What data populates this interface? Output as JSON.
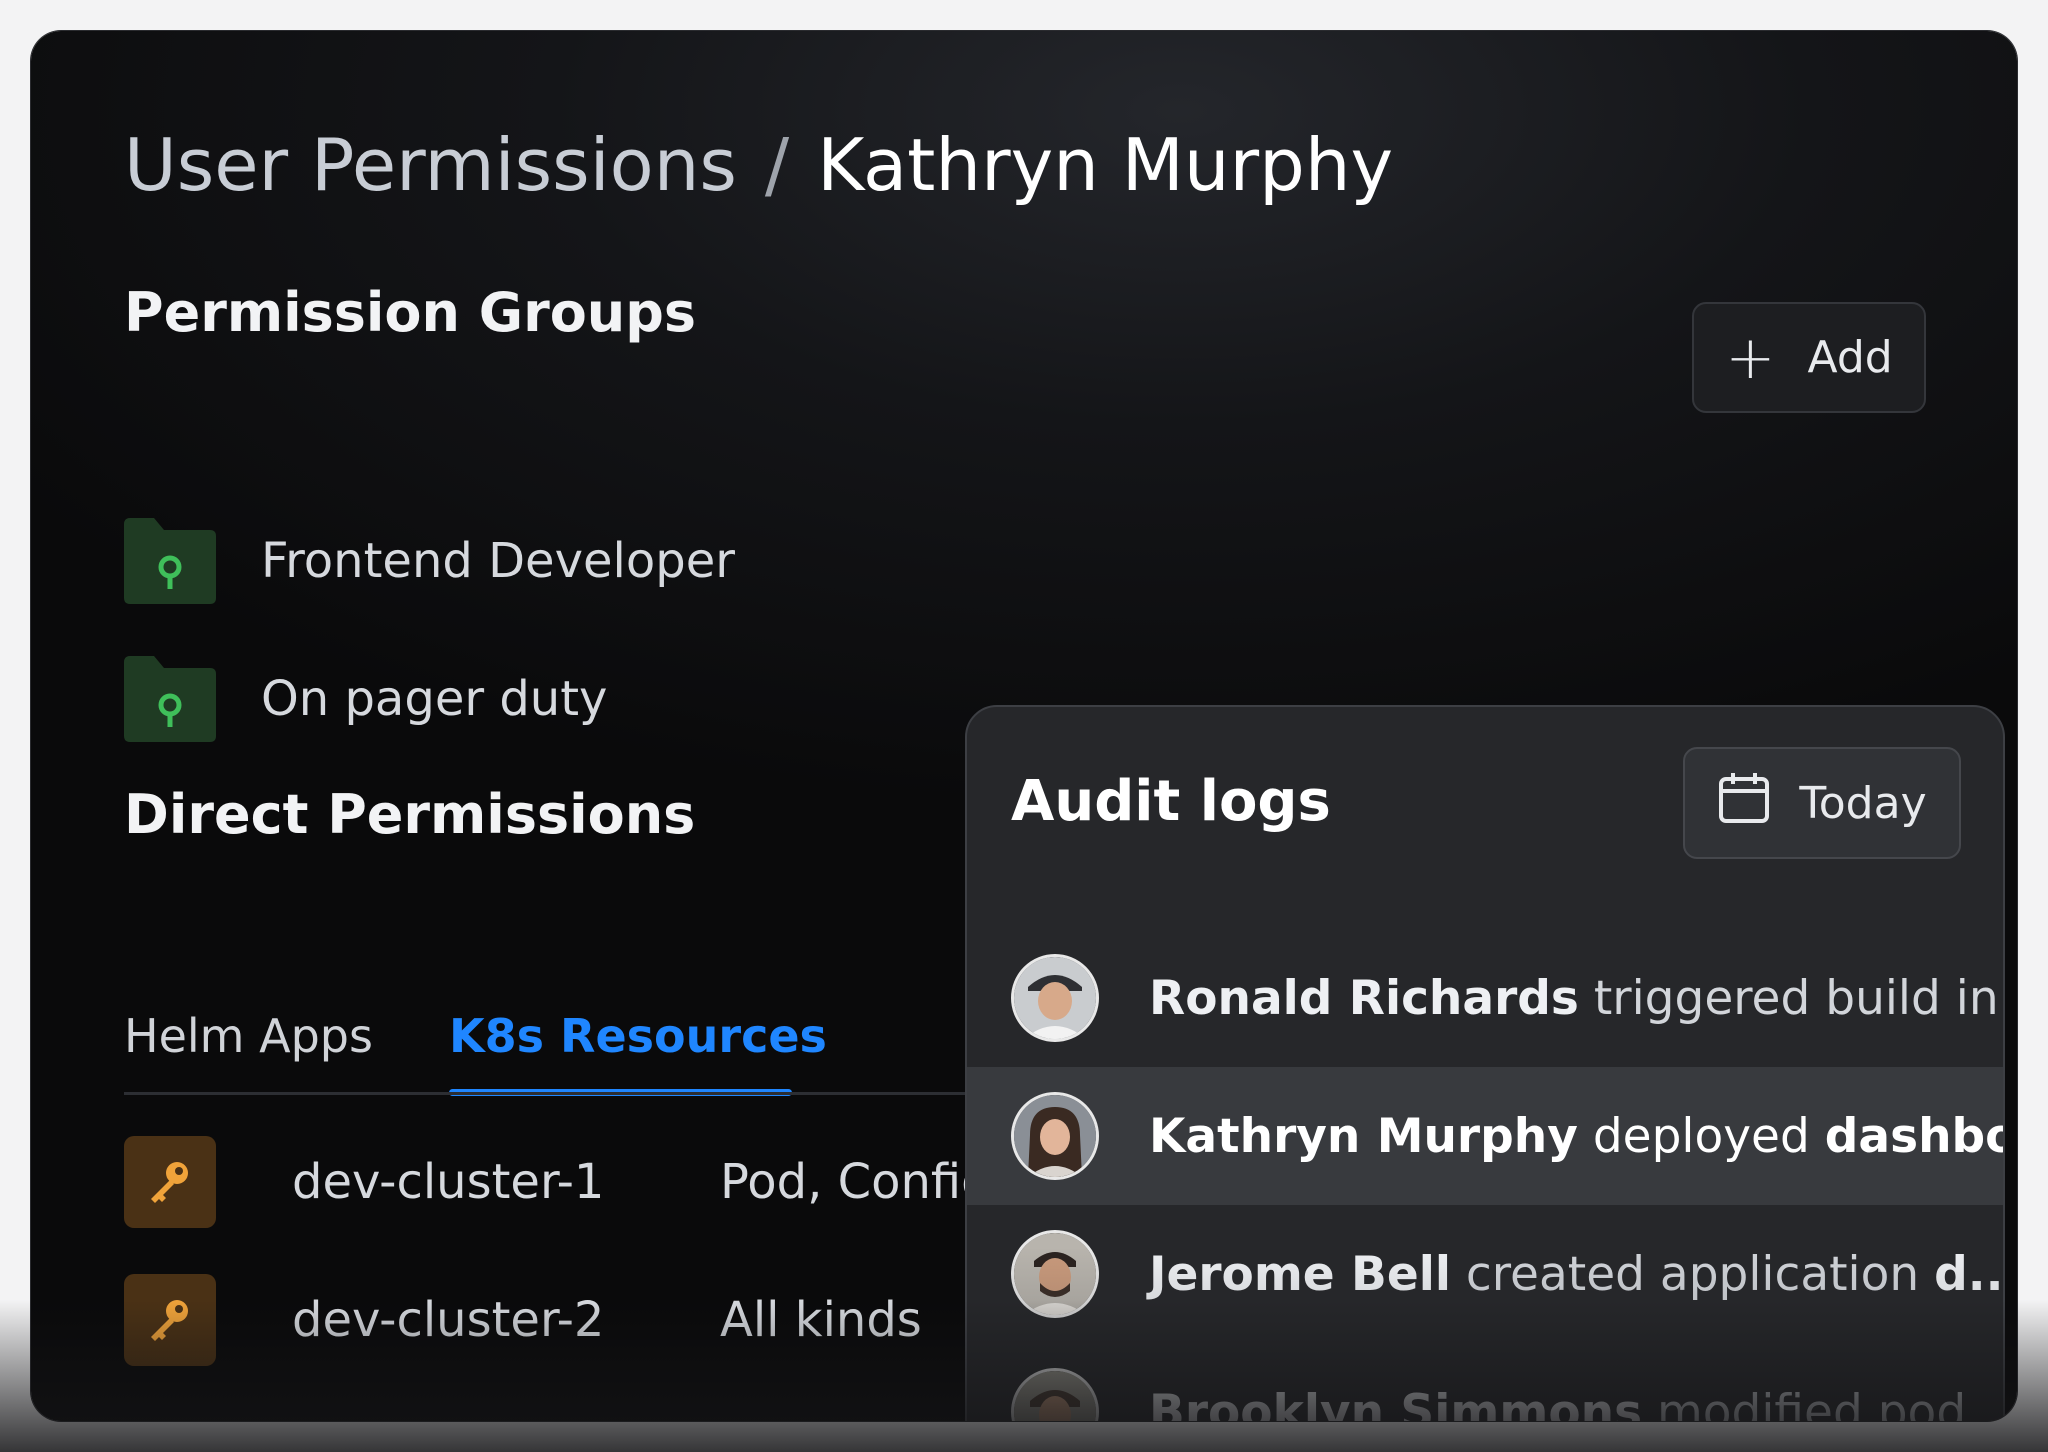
{
  "breadcrumb": {
    "parent": "User Permissions",
    "separator": "/",
    "current": "Kathryn Murphy"
  },
  "permission_groups": {
    "title": "Permission Groups",
    "add_label": "Add",
    "add_icon": "plus-icon",
    "items": [
      {
        "label": "Frontend Developer",
        "icon": "folder-key-icon"
      },
      {
        "label": "On pager duty",
        "icon": "folder-key-icon"
      }
    ]
  },
  "direct_permissions": {
    "title": "Direct Permissions",
    "tabs": [
      {
        "label": "Helm Apps",
        "active": false
      },
      {
        "label": "K8s Resources",
        "active": true
      }
    ],
    "rows": [
      {
        "name": "dev-cluster-1",
        "kinds": "Pod, Config",
        "icon": "key-icon"
      },
      {
        "name": "dev-cluster-2",
        "kinds": "All kinds",
        "icon": "key-icon"
      }
    ]
  },
  "audit_logs": {
    "title": "Audit logs",
    "filter_label": "Today",
    "filter_icon": "calendar-icon",
    "entries": [
      {
        "user": "Ronald Richards",
        "action": "triggered build in...",
        "target": "",
        "active": false
      },
      {
        "user": "Kathryn Murphy",
        "action": "deployed",
        "target": "dashbo...",
        "active": true
      },
      {
        "user": "Jerome Bell",
        "action": "created application",
        "target": "d...",
        "active": false
      },
      {
        "user": "Brooklyn Simmons",
        "action": "modified pod ...",
        "target": "",
        "active": false
      }
    ]
  },
  "colors": {
    "accent": "#1f86ff",
    "folder": "#1f3b23",
    "folder_key": "#3fbf5a",
    "key_tile": "#4a3115",
    "key": "#f0a33a"
  }
}
